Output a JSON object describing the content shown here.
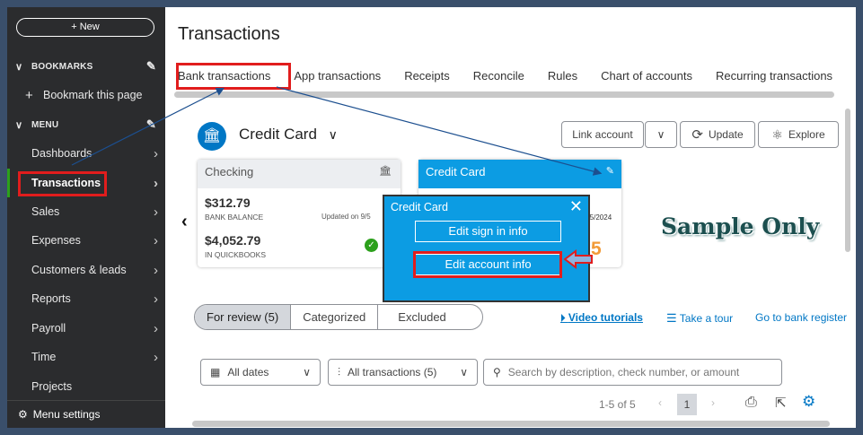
{
  "sidebar": {
    "new_label": "+ New",
    "bookmarks_header": "BOOKMARKS",
    "bookmark_this_page": "Bookmark this page",
    "menu_header": "MENU",
    "items": [
      {
        "label": "Dashboards"
      },
      {
        "label": "Transactions"
      },
      {
        "label": "Sales"
      },
      {
        "label": "Expenses"
      },
      {
        "label": "Customers & leads"
      },
      {
        "label": "Reports"
      },
      {
        "label": "Payroll"
      },
      {
        "label": "Time"
      },
      {
        "label": "Projects"
      }
    ],
    "menu_settings": "Menu settings"
  },
  "header": {
    "title": "Transactions",
    "tabs": [
      {
        "label": "Bank transactions"
      },
      {
        "label": "App transactions"
      },
      {
        "label": "Receipts"
      },
      {
        "label": "Reconcile"
      },
      {
        "label": "Rules"
      },
      {
        "label": "Chart of accounts"
      },
      {
        "label": "Recurring transactions"
      }
    ]
  },
  "account": {
    "name": "Credit Card",
    "link_account": "Link account",
    "update": "Update",
    "explore": "Explore"
  },
  "cards": {
    "checking": {
      "title": "Checking",
      "bank_balance": "$312.79",
      "bank_balance_label": "BANK BALANCE",
      "updated": "Updated on 9/5",
      "qb_balance": "$4,052.79",
      "qb_label": "IN QUICKBOOKS"
    },
    "credit": {
      "title": "Credit Card",
      "date": "9/5/2024"
    }
  },
  "popup": {
    "title": "Credit Card",
    "edit_sign_in": "Edit sign in info",
    "edit_account": "Edit account info",
    "step_number": "5"
  },
  "watermark": "Sample Only",
  "review_tabs": [
    {
      "label": "For review (5)"
    },
    {
      "label": "Categorized"
    },
    {
      "label": "Excluded"
    }
  ],
  "links": {
    "video": "Video tutorials",
    "tour": "Take a tour",
    "register": "Go to bank register"
  },
  "filters": {
    "dates": "All dates",
    "transactions": "All transactions (5)",
    "search_placeholder": "Search by description, check number, or amount"
  },
  "pager": {
    "range": "1-5 of 5",
    "current": "1"
  },
  "colors": {
    "sidebar_bg": "#2b2c2e",
    "accent_blue": "#0077c5",
    "card_blue": "#0c9ce3",
    "highlight_red": "#e11d1d",
    "active_green": "#2ca01c"
  }
}
